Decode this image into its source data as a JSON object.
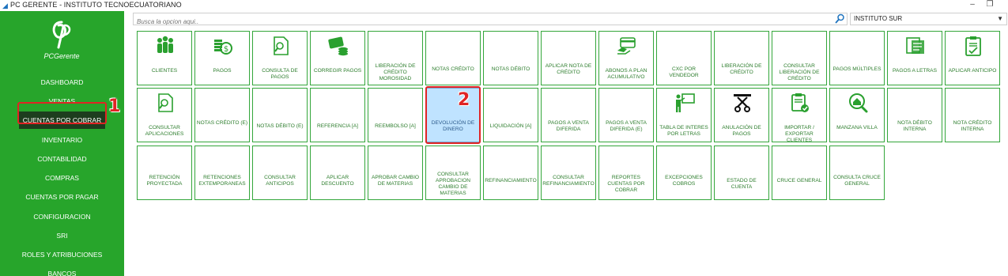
{
  "window": {
    "title": "PC GERENTE - INSTITUTO TECNOECUATORIANO",
    "minimize": "–",
    "restore": "❐"
  },
  "sidebar": {
    "logo_text": "PCGerente",
    "items": [
      {
        "label": "DASHBOARD"
      },
      {
        "label": "VENTAS"
      },
      {
        "label": "CUENTAS POR COBRAR"
      },
      {
        "label": "INVENTARIO"
      },
      {
        "label": "CONTABILIDAD"
      },
      {
        "label": "COMPRAS"
      },
      {
        "label": "CUENTAS POR PAGAR"
      },
      {
        "label": "CONFIGURACION"
      },
      {
        "label": "SRI"
      },
      {
        "label": "ROLES Y ATRIBUCIONES"
      },
      {
        "label": "BANCOS"
      }
    ],
    "active_index": 2
  },
  "annotations": {
    "step1": "1",
    "step2": "2"
  },
  "search": {
    "placeholder": "Busca la opcion aqui..",
    "icon": "search-icon"
  },
  "branch": {
    "selected": "INSTITUTO SUR"
  },
  "colors": {
    "sidebar": "#27a52b",
    "tile_border": "#33a63a",
    "tile_text": "#2c7d2c",
    "selected_tile": "#bfe3ff",
    "annotation": "#e02424"
  },
  "tiles": [
    [
      {
        "label": "CLIENTES",
        "icon": "users"
      },
      {
        "label": "PAGOS",
        "icon": "coins"
      },
      {
        "label": "CONSULTA DE PAGOS",
        "icon": "doc-search"
      },
      {
        "label": "CORREGIR PAGOS",
        "icon": "card-coins"
      },
      {
        "label": "LIBERACIÓN DE CRÉDITO MOROSIDAD",
        "icon": ""
      },
      {
        "label": "NOTAS CRÉDITO",
        "icon": ""
      },
      {
        "label": "NOTAS DÉBITO",
        "icon": ""
      },
      {
        "label": "APLICAR NOTA DE CRÉDITO",
        "icon": ""
      },
      {
        "label": "ABONOS A PLAN ACUMULATIVO",
        "icon": "card-hand"
      },
      {
        "label": "CXC POR VENDEDOR",
        "icon": ""
      },
      {
        "label": "LIBERACIÓN DE CRÉDITO",
        "icon": ""
      },
      {
        "label": "CONSULTAR LIBERACIÓN DE CRÉDITO",
        "icon": ""
      },
      {
        "label": "PAGOS MÚLTIPLES",
        "icon": ""
      },
      {
        "label": "PAGOS A LETRAS",
        "icon": "invoice"
      },
      {
        "label": "APLICAR ANTICIPO",
        "icon": "clipboard-check"
      }
    ],
    [
      {
        "label": "CONSULTAR APLICACIONES",
        "icon": "doc-search"
      },
      {
        "label": "NOTAS CRÉDITO (E)",
        "icon": ""
      },
      {
        "label": "NOTAS DÉBITO (E)",
        "icon": ""
      },
      {
        "label": "REFERENCIA [A]",
        "icon": ""
      },
      {
        "label": "REEMBOLSO [A]",
        "icon": ""
      },
      {
        "label": "DEVOLUCIÓN DE DINERO",
        "icon": ""
      },
      {
        "label": "LIQUIDACIÓN [A]",
        "icon": ""
      },
      {
        "label": "PAGOS A VENTA DIFERIDA",
        "icon": ""
      },
      {
        "label": "PAGOS A VENTA DIFERIDA (E)",
        "icon": ""
      },
      {
        "label": "TABLA DE INTERES POR LETRAS",
        "icon": "presenter"
      },
      {
        "label": "ANULACIÓN DE PAGOS",
        "icon": "scissors"
      },
      {
        "label": "IMPORTAR / EXPORTAR CLIENTES",
        "icon": "clipboard-badge"
      },
      {
        "label": "MANZANA VILLA",
        "icon": "house-search"
      },
      {
        "label": "NOTA DÉBITO INTERNA",
        "icon": ""
      },
      {
        "label": "NOTA CRÉDITO INTERNA",
        "icon": ""
      }
    ],
    [
      {
        "label": "RETENCIÓN PROYECTADA",
        "icon": ""
      },
      {
        "label": "RETENCIONES EXTEMPORANEAS",
        "icon": ""
      },
      {
        "label": "CONSULTAR ANTICIPOS",
        "icon": ""
      },
      {
        "label": "APLICAR DESCUENTO",
        "icon": ""
      },
      {
        "label": "APROBAR CAMBIO DE MATERIAS",
        "icon": ""
      },
      {
        "label": "CONSULTAR APROBACION CAMBIO DE MATERIAS",
        "icon": ""
      },
      {
        "label": "REFINANCIAMIENTO",
        "icon": ""
      },
      {
        "label": "CONSULTAR REFINANCIAMIENTO",
        "icon": ""
      },
      {
        "label": "REPORTES CUENTAS POR COBRAR",
        "icon": ""
      },
      {
        "label": "EXCEPCIONES COBROS",
        "icon": ""
      },
      {
        "label": "ESTADO DE CUENTA",
        "icon": ""
      },
      {
        "label": "CRUCE GENERAL",
        "icon": ""
      },
      {
        "label": "CONSULTA CRUCE GENERAL",
        "icon": ""
      }
    ]
  ],
  "selected_tile": {
    "row": 1,
    "col": 5
  }
}
